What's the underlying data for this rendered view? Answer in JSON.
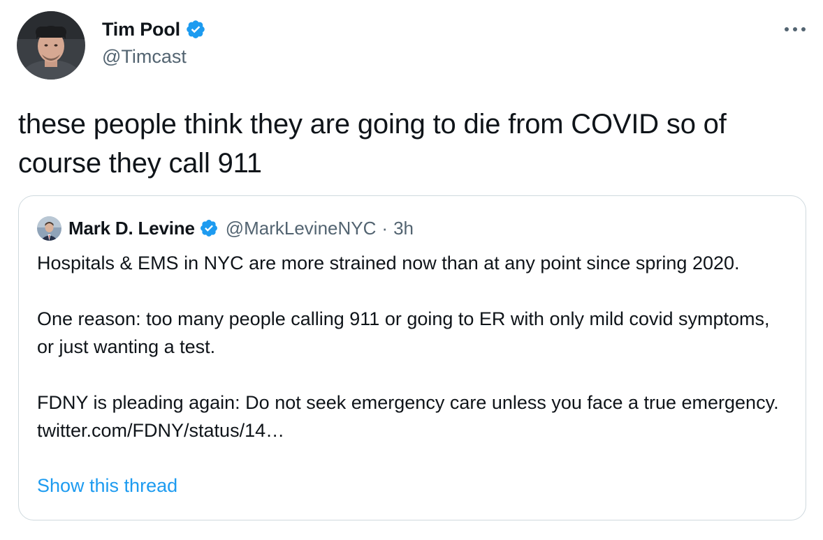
{
  "author": {
    "display_name": "Tim Pool",
    "handle": "@Timcast",
    "verified": true,
    "avatar_icon": "profile-photo"
  },
  "tweet": {
    "text": "these people think they are going to die from COVID so of course they call 911"
  },
  "quoted_tweet": {
    "display_name": "Mark D. Levine",
    "handle": "@MarkLevineNYC",
    "separator": "·",
    "time": "3h",
    "verified": true,
    "paragraphs": [
      "Hospitals & EMS in NYC are more strained now than at any point since spring 2020.",
      "One reason: too many people calling 911 or going to ER with only mild covid symptoms, or just wanting a test.",
      "FDNY is pleading again: Do not seek emergency care unless you face a true emergency. twitter.com/FDNY/status/14…"
    ],
    "show_thread_label": "Show this thread"
  },
  "colors": {
    "text_primary": "#0f1419",
    "text_secondary": "#536471",
    "accent": "#1d9bf0",
    "border": "#cfd9de"
  },
  "icons": {
    "verified": "verified-badge-icon",
    "more": "more-horizontal-icon"
  }
}
